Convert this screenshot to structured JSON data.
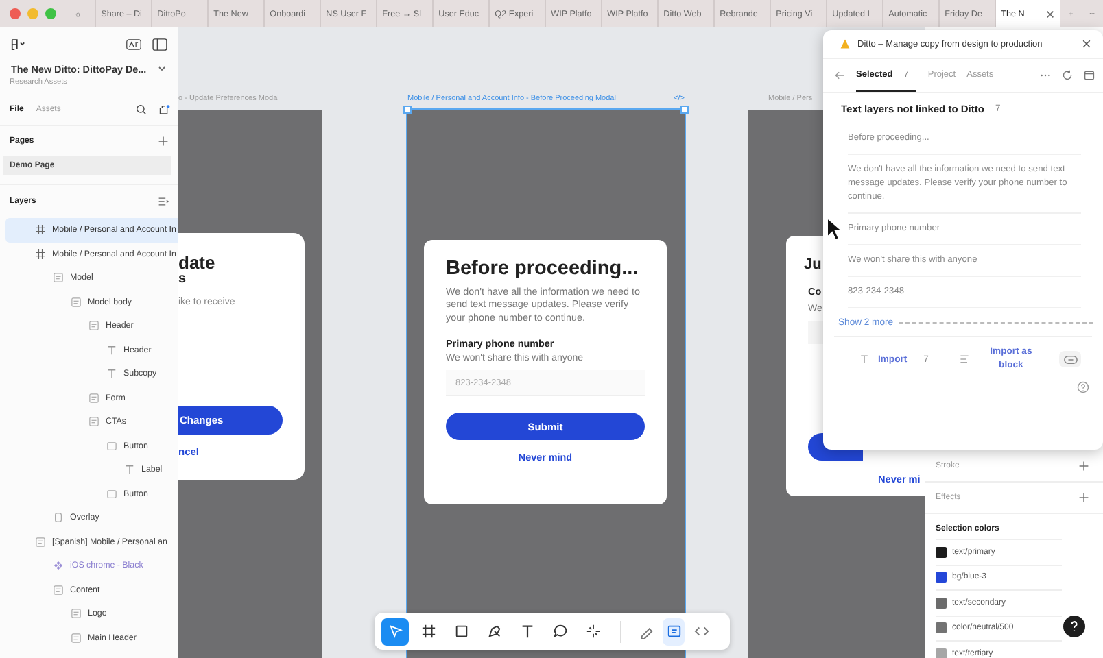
{
  "browser": {
    "tabs": [
      {
        "label": "Share – Di",
        "selected": false
      },
      {
        "label": "DittoPo",
        "selected": false
      },
      {
        "label": "The New",
        "selected": false
      },
      {
        "label": "Onboardi",
        "selected": false
      },
      {
        "label": "NS User F",
        "selected": false
      },
      {
        "label": "Free → Sl",
        "selected": false
      },
      {
        "label": "User Educ",
        "selected": false
      },
      {
        "label": "Q2 Experi",
        "selected": false
      },
      {
        "label": "WIP Platfo",
        "selected": false
      },
      {
        "label": "WIP Platfo",
        "selected": false
      },
      {
        "label": "Ditto Web",
        "selected": false
      },
      {
        "label": "Rebrande",
        "selected": false
      },
      {
        "label": "Pricing Vi",
        "selected": false
      },
      {
        "label": "Updated I",
        "selected": false
      },
      {
        "label": "Automatic",
        "selected": false
      },
      {
        "label": "Friday De",
        "selected": false
      },
      {
        "label": "The N",
        "selected": true
      }
    ]
  },
  "file": {
    "title": "The New Ditto: DittoPay De...",
    "subtitle": "Research Assets"
  },
  "sidebar_tabs": [
    {
      "label": "File",
      "selected": true
    },
    {
      "label": "Assets",
      "selected": false
    }
  ],
  "pages": {
    "heading": "Pages",
    "items": [
      {
        "label": "Demo Page",
        "selected": true
      }
    ]
  },
  "layers": {
    "heading": "Layers",
    "items": [
      {
        "label": "Mobile / Personal and Account In",
        "kind": "frame",
        "selected": true
      },
      {
        "label": "Mobile / Personal and Account In",
        "kind": "frame",
        "selected": false,
        "children": [
          {
            "label": "Model",
            "kind": "autolayout",
            "selected": false,
            "children": [
              {
                "label": "Model body",
                "kind": "autolayout",
                "selected": false,
                "children": [
                  {
                    "label": "Header",
                    "kind": "autolayout",
                    "selected": false,
                    "children": [
                      {
                        "label": "Header",
                        "kind": "text",
                        "selected": false
                      },
                      {
                        "label": "Subcopy",
                        "kind": "text",
                        "selected": false
                      }
                    ]
                  },
                  {
                    "label": "Form",
                    "kind": "autolayout",
                    "selected": false
                  },
                  {
                    "label": "CTAs",
                    "kind": "autolayout",
                    "selected": false,
                    "children": [
                      {
                        "label": "Button",
                        "kind": "instance",
                        "selected": false,
                        "children": [
                          {
                            "label": "Label",
                            "kind": "text",
                            "selected": false
                          }
                        ]
                      },
                      {
                        "label": "Button",
                        "kind": "instance",
                        "selected": false
                      }
                    ]
                  }
                ]
              }
            ]
          },
          {
            "label": "Overlay",
            "kind": "rect",
            "selected": false
          }
        ]
      },
      {
        "label": "[Spanish] Mobile / Personal an",
        "kind": "autolayout",
        "selected": false,
        "children": [
          {
            "label": "iOS chrome - Black",
            "kind": "component",
            "selected": false
          },
          {
            "label": "Content",
            "kind": "autolayout",
            "selected": false,
            "children": [
              {
                "label": "Logo",
                "kind": "autolayout",
                "selected": false
              },
              {
                "label": "Main Header",
                "kind": "autolayout",
                "selected": false
              }
            ]
          }
        ]
      }
    ]
  },
  "canvas": {
    "left_frame": {
      "label": "o - Update Preferences Modal",
      "title": "date",
      "title_2": "s",
      "body": "ike to receive",
      "primary_button": "Changes",
      "secondary_link": "ncel"
    },
    "main_frame": {
      "label": "Mobile / Personal and Account Info - Before Proceeding Modal",
      "badge": "</>",
      "selected": true,
      "title": "Before proceeding...",
      "body": "We don't have all the information we need to send text message updates. Please verify your phone number to continue.",
      "field_label": "Primary phone number",
      "field_hint": "We won't share this with anyone",
      "placeholder": "823-234-2348",
      "submit": "Submit",
      "cancel": "Never mind"
    },
    "right_frame": {
      "label": "Mobile / Pers",
      "title": "Ju",
      "field_label": "Co",
      "field_hint": "We",
      "link": "Never mi"
    }
  },
  "plugin": {
    "title": "Ditto – Manage copy from design to production",
    "tabs": [
      {
        "label": "Selected",
        "count": "7",
        "selected": true
      },
      {
        "label": "Project",
        "selected": false
      },
      {
        "label": "Assets",
        "selected": false
      }
    ],
    "heading": "Text layers not linked to Ditto",
    "heading_count": "7",
    "items": [
      "Before proceeding...",
      "We don't have all the information we need to send text message updates. Please verify your phone number to continue.",
      "Primary phone number",
      "We won't share this with anyone",
      "823-234-2348"
    ],
    "show_more": "Show 2 more",
    "import": "Import",
    "import_count": "7",
    "import_block": "Import as block"
  },
  "right_panel": {
    "sections": [
      "Stroke",
      "Effects"
    ],
    "selection_colors": {
      "heading": "Selection colors",
      "items": [
        {
          "name": "text/primary",
          "color": "#1c1c1c"
        },
        {
          "name": "bg/blue-3",
          "color": "#2447d8"
        },
        {
          "name": "text/secondary",
          "color": "#6b6b6b"
        },
        {
          "name": "color/neutral/500",
          "color": "#737373"
        },
        {
          "name": "text/tertiary",
          "color": "#a6a6a6"
        }
      ]
    }
  },
  "toolbar": {
    "tools": [
      {
        "kind": "move",
        "selected": true
      },
      {
        "kind": "frame",
        "selected": false
      },
      {
        "kind": "rect",
        "selected": false
      },
      {
        "kind": "pen",
        "selected": false
      },
      {
        "kind": "text",
        "selected": false
      },
      {
        "kind": "comment",
        "selected": false
      },
      {
        "kind": "actions",
        "selected": false
      }
    ],
    "modes": [
      {
        "kind": "draw",
        "selected": false
      },
      {
        "kind": "design",
        "selected": true
      },
      {
        "kind": "dev",
        "selected": false
      }
    ]
  }
}
